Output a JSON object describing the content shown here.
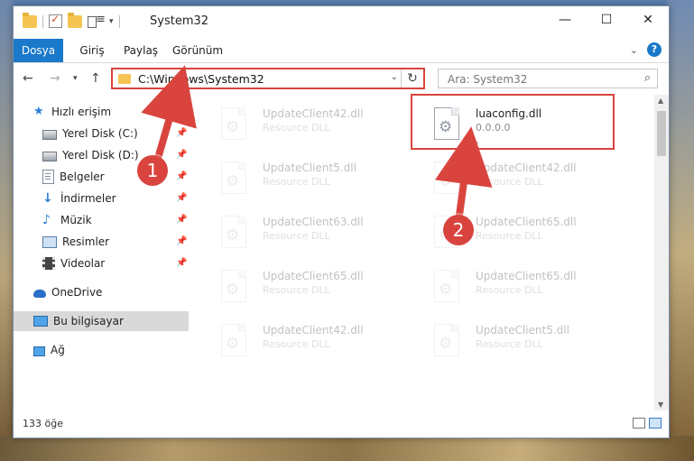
{
  "window": {
    "title": "System32",
    "controls": {
      "minimize": "—",
      "maximize": "☐",
      "close": "✕"
    }
  },
  "ribbon": {
    "file_tab": "Dosya",
    "tabs": [
      "Giriş",
      "Paylaş",
      "Görünüm"
    ],
    "expand_glyph": "⌄",
    "help_glyph": "?"
  },
  "nav": {
    "back": "←",
    "forward": "→",
    "recent": "▾",
    "up": "↑",
    "address_path": "C:\\Windows\\System32",
    "address_dropdown": "⌄",
    "refresh": "↻",
    "search_placeholder": "Ara: System32",
    "search_icon": "⌕"
  },
  "sidebar": {
    "quick_access": "Hızlı erişim",
    "items": [
      {
        "label": "Yerel Disk (C:)",
        "icon": "disk-icon",
        "pinned": true
      },
      {
        "label": "Yerel Disk (D:)",
        "icon": "disk-icon",
        "pinned": true
      },
      {
        "label": "Belgeler",
        "icon": "documents-icon",
        "pinned": true
      },
      {
        "label": "İndirmeler",
        "icon": "downloads-icon",
        "pinned": true
      },
      {
        "label": "Müzik",
        "icon": "music-icon",
        "pinned": true
      },
      {
        "label": "Resimler",
        "icon": "pictures-icon",
        "pinned": true
      },
      {
        "label": "Videolar",
        "icon": "videos-icon",
        "pinned": true
      }
    ],
    "onedrive": "OneDrive",
    "this_pc": "Bu bilgisayar",
    "network": "Ağ",
    "pin_glyph": "📌"
  },
  "files": {
    "left_column": [
      {
        "name": "UpdateClient42.dll",
        "desc": "Resource DLL"
      },
      {
        "name": "UpdateClient5.dll",
        "desc": "Resource DLL"
      },
      {
        "name": "UpdateClient63.dll",
        "desc": "Resource DLL"
      },
      {
        "name": "UpdateClient65.dll",
        "desc": "Resource DLL"
      },
      {
        "name": "UpdateClient42.dll",
        "desc": "Resource DLL"
      }
    ],
    "highlighted": {
      "name": "luaconfig.dll",
      "desc": "0.0.0.0",
      "extra": "-"
    },
    "right_column": [
      {
        "name": "UpdateClient42.dll",
        "desc": "Resource DLL"
      },
      {
        "name": "UpdateClient65.dll",
        "desc": "Resource DLL"
      },
      {
        "name": "UpdateClient65.dll",
        "desc": "Resource DLL"
      },
      {
        "name": "UpdateClient5.dll",
        "desc": "Resource DLL"
      }
    ],
    "gear_glyph": "⚙"
  },
  "status": {
    "item_count": "133 öğe"
  },
  "annotations": {
    "step1": "1",
    "step2": "2",
    "color": "#d9443e"
  }
}
